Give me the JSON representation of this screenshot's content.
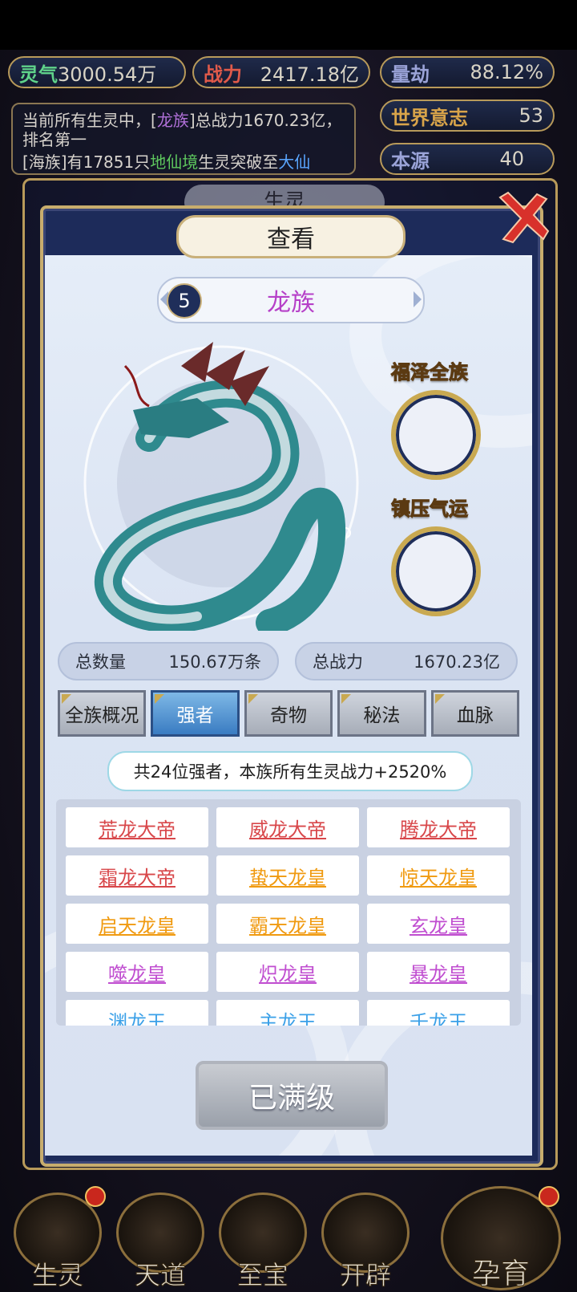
{
  "top_stats": {
    "lingqi": {
      "label": "灵气",
      "value": "3000.54万"
    },
    "zhanli": {
      "label": "战力",
      "value": "2417.18亿"
    },
    "liangjie": {
      "label": "量劫",
      "value": "88.12%"
    },
    "shijie": {
      "label": "世界意志",
      "value": "53"
    },
    "benyuan": {
      "label": "本源",
      "value": "40"
    }
  },
  "message": {
    "line1_a": "当前所有生灵中，[",
    "line1_race": "龙族",
    "line1_b": "]总战力1670.23亿，排名第一",
    "line2_a": "[海族]有17851只",
    "line2_realm": "地仙境",
    "line2_b": "生灵突破至",
    "line2_realm2": "大仙"
  },
  "behind_panel_title": "生灵",
  "dialog": {
    "title": "查看",
    "race_level": "5",
    "race_name": "龙族",
    "slot1_label": "福泽全族",
    "slot2_label": "镇压气运",
    "total_count_label": "总数量",
    "total_count_value": "150.67万条",
    "total_power_label": "总战力",
    "total_power_value": "1670.23亿",
    "tabs": [
      "全族概况",
      "强者",
      "奇物",
      "秘法",
      "血脉"
    ],
    "active_tab": "强者",
    "summary": "共24位强者，本族所有生灵战力+2520%",
    "strongmen": [
      {
        "name": "荒龙大帝",
        "color": "#d8474a"
      },
      {
        "name": "威龙大帝",
        "color": "#d8474a"
      },
      {
        "name": "腾龙大帝",
        "color": "#d8474a"
      },
      {
        "name": "霜龙大帝",
        "color": "#d8474a"
      },
      {
        "name": "蛰天龙皇",
        "color": "#f09a10"
      },
      {
        "name": "惊天龙皇",
        "color": "#f09a10"
      },
      {
        "name": "启天龙皇",
        "color": "#f09a10"
      },
      {
        "name": "霸天龙皇",
        "color": "#f09a10"
      },
      {
        "name": "玄龙皇",
        "color": "#c04ed0"
      },
      {
        "name": "噬龙皇",
        "color": "#c04ed0"
      },
      {
        "name": "炽龙皇",
        "color": "#c04ed0"
      },
      {
        "name": "暴龙皇",
        "color": "#c04ed0"
      },
      {
        "name": "渊龙王",
        "color": "#3aa0e8"
      },
      {
        "name": "主龙王",
        "color": "#3aa0e8"
      },
      {
        "name": "千龙王",
        "color": "#3aa0e8"
      }
    ],
    "max_button": "已满级"
  },
  "nav": [
    "生灵",
    "天道",
    "至宝",
    "开辟",
    "孕育"
  ]
}
